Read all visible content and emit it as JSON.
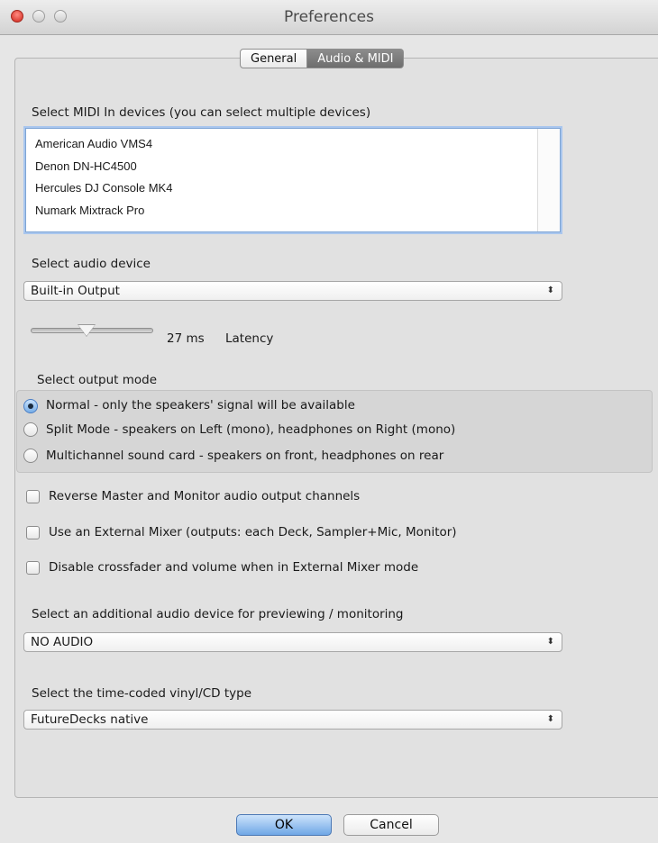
{
  "window": {
    "title": "Preferences"
  },
  "tabs": [
    {
      "label": "General",
      "selected": false
    },
    {
      "label": "Audio & MIDI",
      "selected": true
    }
  ],
  "midi": {
    "label": "Select MIDI In devices (you can select multiple devices)",
    "devices": [
      "American Audio VMS4",
      "Denon DN-HC4500",
      "Hercules DJ Console MK4",
      "Numark Mixtrack Pro"
    ]
  },
  "audio_device": {
    "label": "Select audio device",
    "value": "Built-in Output"
  },
  "latency": {
    "value_text": "27 ms",
    "label": "Latency"
  },
  "output_mode": {
    "label": "Select output mode",
    "options": [
      {
        "label": "Normal - only the speakers' signal will be available",
        "selected": true
      },
      {
        "label": "Split Mode - speakers on Left (mono), headphones on Right (mono)",
        "selected": false
      },
      {
        "label": "Multichannel sound card - speakers on front, headphones on rear",
        "selected": false
      }
    ]
  },
  "checkboxes": [
    {
      "label": "Reverse Master and Monitor audio output channels",
      "checked": false
    },
    {
      "label": "Use an External Mixer (outputs: each Deck, Sampler+Mic, Monitor)",
      "checked": false
    },
    {
      "label": "Disable crossfader and volume when in External Mixer mode",
      "checked": false
    }
  ],
  "preview_device": {
    "label": "Select an additional audio device for previewing / monitoring",
    "value": "NO AUDIO"
  },
  "vinyl_type": {
    "label": "Select the time-coded vinyl/CD type",
    "value": "FutureDecks native"
  },
  "buttons": {
    "ok": "OK",
    "cancel": "Cancel"
  },
  "icons": {
    "select_arrows": "⬍"
  },
  "colors": {
    "accent": "#6fa7e6",
    "focus_ring": "#a9c6ee",
    "close": "#d0251b"
  }
}
